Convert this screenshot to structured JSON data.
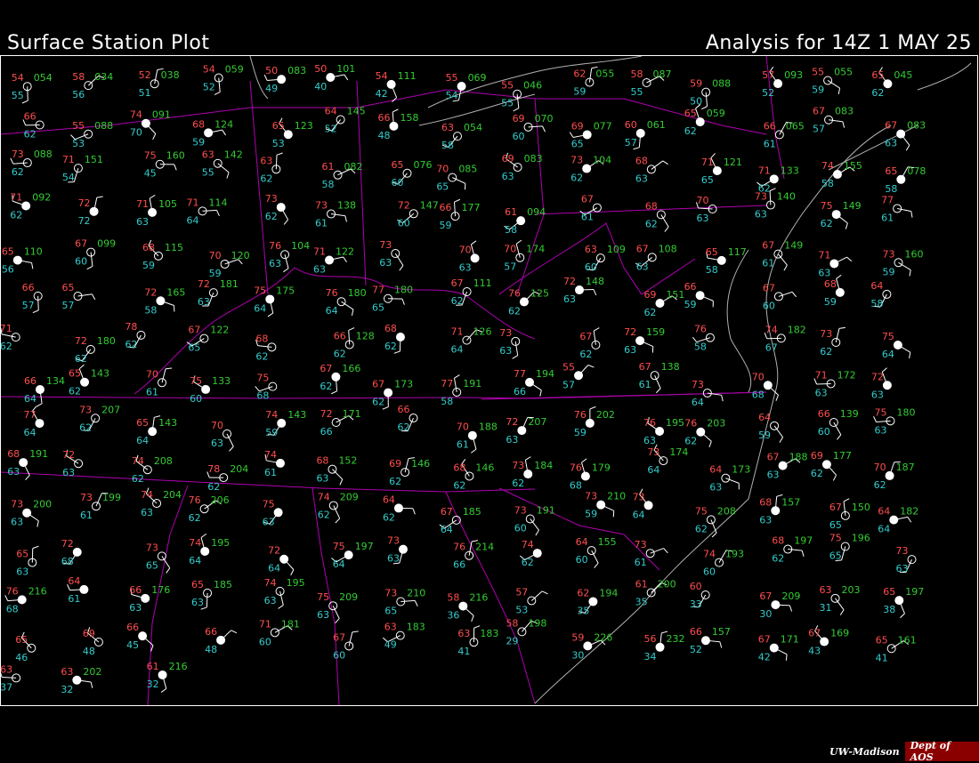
{
  "header": {
    "title": "Surface Station Plot",
    "analysis": "Analysis for 14Z  1 MAY 25"
  },
  "credit": {
    "institution": "UW-Madison",
    "department": "Dept of AOS"
  },
  "colors": {
    "background": "#000000",
    "temperature": "#ff4d4d",
    "dewpoint": "#33cccc",
    "pressure": "#33cc33",
    "state_boundary": "#b000b0",
    "coastline": "#b0b0b0",
    "station": "#ffffff",
    "weather_symbol": "#ffff00"
  },
  "stations": [
    {
      "t": "54",
      "td": "55",
      "p": "054"
    },
    {
      "t": "58",
      "td": "56",
      "p": "034"
    },
    {
      "t": "52",
      "td": "51",
      "p": "038"
    },
    {
      "t": "54",
      "td": "52",
      "p": "059"
    },
    {
      "t": "50",
      "td": "49",
      "p": "083"
    },
    {
      "t": "50",
      "td": "40",
      "p": "101"
    },
    {
      "t": "54",
      "td": "42",
      "p": "111"
    },
    {
      "t": "55",
      "td": "54",
      "p": "069"
    },
    {
      "t": "55",
      "td": "55",
      "p": "046"
    },
    {
      "t": "62",
      "td": "59",
      "p": "055"
    },
    {
      "t": "58",
      "td": "55",
      "p": "087"
    },
    {
      "t": "59",
      "td": "50",
      "p": "088"
    },
    {
      "t": "57",
      "td": "52",
      "p": "093"
    },
    {
      "t": "55",
      "td": "59",
      "p": "055"
    },
    {
      "t": "65",
      "td": "62",
      "p": "045"
    },
    {
      "t": "66",
      "td": "62",
      "p": ""
    },
    {
      "t": "55",
      "td": "53",
      "p": "088"
    },
    {
      "t": "74",
      "td": "70",
      "p": "091"
    },
    {
      "t": "68",
      "td": "59",
      "p": "124"
    },
    {
      "t": "65",
      "td": "53",
      "p": "123"
    },
    {
      "t": "64",
      "td": "52",
      "p": "145"
    },
    {
      "t": "66",
      "td": "48",
      "p": "158"
    },
    {
      "t": "63",
      "td": "58",
      "p": "054"
    },
    {
      "t": "69",
      "td": "60",
      "p": "070"
    },
    {
      "t": "69",
      "td": "65",
      "p": "077"
    },
    {
      "t": "60",
      "td": "57",
      "p": "061"
    },
    {
      "t": "65",
      "td": "62",
      "p": "059"
    },
    {
      "t": "66",
      "td": "61",
      "p": "065"
    },
    {
      "t": "67",
      "td": "57",
      "p": "083"
    },
    {
      "t": "67",
      "td": "63",
      "p": "083"
    },
    {
      "t": "73",
      "td": "62",
      "p": "088"
    },
    {
      "t": "71",
      "td": "54",
      "p": "151"
    },
    {
      "t": "75",
      "td": "45",
      "p": "160"
    },
    {
      "t": "63",
      "td": "55",
      "p": "142"
    },
    {
      "t": "63",
      "td": "62",
      "p": ""
    },
    {
      "t": "61",
      "td": "58",
      "p": "082"
    },
    {
      "t": "65",
      "td": "60",
      "p": "076"
    },
    {
      "t": "70",
      "td": "65",
      "p": "085"
    },
    {
      "t": "69",
      "td": "63",
      "p": "083"
    },
    {
      "t": "73",
      "td": "62",
      "p": "104"
    },
    {
      "t": "68",
      "td": "63",
      "p": ""
    },
    {
      "t": "71",
      "td": "65",
      "p": "121"
    },
    {
      "t": "71",
      "td": "62",
      "p": "133"
    },
    {
      "t": "74",
      "td": "58",
      "p": "155"
    },
    {
      "t": "65",
      "td": "58",
      "p": "078"
    },
    {
      "t": "71",
      "td": "62",
      "p": "092"
    },
    {
      "t": "72",
      "td": "72",
      "p": ""
    },
    {
      "t": "71",
      "td": "63",
      "p": "105"
    },
    {
      "t": "71",
      "td": "64",
      "p": "114"
    },
    {
      "t": "73",
      "td": "62",
      "p": ""
    },
    {
      "t": "73",
      "td": "61",
      "p": "138"
    },
    {
      "t": "72",
      "td": "60",
      "p": "147"
    },
    {
      "t": "66",
      "td": "59",
      "p": "177"
    },
    {
      "t": "61",
      "td": "58",
      "p": "094"
    },
    {
      "t": "67",
      "td": "61",
      "p": ""
    },
    {
      "t": "68",
      "td": "62",
      "p": ""
    },
    {
      "t": "70",
      "td": "63",
      "p": ""
    },
    {
      "t": "73",
      "td": "63",
      "p": "140"
    },
    {
      "t": "75",
      "td": "62",
      "p": "149"
    },
    {
      "t": "77",
      "td": "61",
      "p": ""
    },
    {
      "t": "65",
      "td": "56",
      "p": "110"
    },
    {
      "t": "67",
      "td": "60",
      "p": "099"
    },
    {
      "t": "68",
      "td": "59",
      "p": "115"
    },
    {
      "t": "70",
      "td": "59",
      "p": "120"
    },
    {
      "t": "76",
      "td": "63",
      "p": "104"
    },
    {
      "t": "71",
      "td": "63",
      "p": "122"
    },
    {
      "t": "73",
      "td": "63",
      "p": ""
    },
    {
      "t": "70",
      "td": "63",
      "p": ""
    },
    {
      "t": "70",
      "td": "57",
      "p": "174"
    },
    {
      "t": "63",
      "td": "60",
      "p": "109"
    },
    {
      "t": "67",
      "td": "63",
      "p": "108"
    },
    {
      "t": "65",
      "td": "58",
      "p": "117"
    },
    {
      "t": "67",
      "td": "61",
      "p": "149"
    },
    {
      "t": "71",
      "td": "63",
      "p": ""
    },
    {
      "t": "73",
      "td": "59",
      "p": "160"
    },
    {
      "t": "66",
      "td": "57",
      "p": ""
    },
    {
      "t": "65",
      "td": "57",
      "p": ""
    },
    {
      "t": "72",
      "td": "58",
      "p": "165"
    },
    {
      "t": "72",
      "td": "63",
      "p": "181"
    },
    {
      "t": "75",
      "td": "64",
      "p": "175"
    },
    {
      "t": "76",
      "td": "64",
      "p": "180"
    },
    {
      "t": "77",
      "td": "65",
      "p": "180"
    },
    {
      "t": "67",
      "td": "62",
      "p": "111"
    },
    {
      "t": "76",
      "td": "62",
      "p": "125"
    },
    {
      "t": "72",
      "td": "63",
      "p": "148"
    },
    {
      "t": "69",
      "td": "62",
      "p": "151"
    },
    {
      "t": "66",
      "td": "59",
      "p": ""
    },
    {
      "t": "67",
      "td": "60",
      "p": ""
    },
    {
      "t": "68",
      "td": "59",
      "p": ""
    },
    {
      "t": "64",
      "td": "58",
      "p": ""
    },
    {
      "t": "71",
      "td": "62",
      "p": ""
    },
    {
      "t": "72",
      "td": "62",
      "p": "180"
    },
    {
      "t": "78",
      "td": "62",
      "p": ""
    },
    {
      "t": "67",
      "td": "65",
      "p": "122"
    },
    {
      "t": "68",
      "td": "62",
      "p": ""
    },
    {
      "t": "66",
      "td": "62",
      "p": "128"
    },
    {
      "t": "68",
      "td": "62",
      "p": ""
    },
    {
      "t": "71",
      "td": "64",
      "p": "126"
    },
    {
      "t": "73",
      "td": "63",
      "p": ""
    },
    {
      "t": "67",
      "td": "62",
      "p": ""
    },
    {
      "t": "72",
      "td": "63",
      "p": "159"
    },
    {
      "t": "76",
      "td": "58",
      "p": ""
    },
    {
      "t": "74",
      "td": "67",
      "p": "182"
    },
    {
      "t": "73",
      "td": "62",
      "p": ""
    },
    {
      "t": "75",
      "td": "64",
      "p": ""
    },
    {
      "t": "66",
      "td": "64",
      "p": "134"
    },
    {
      "t": "65",
      "td": "62",
      "p": "143"
    },
    {
      "t": "70",
      "td": "61",
      "p": ""
    },
    {
      "t": "75",
      "td": "60",
      "p": "133"
    },
    {
      "t": "75",
      "td": "68",
      "p": ""
    },
    {
      "t": "67",
      "td": "62",
      "p": "166"
    },
    {
      "t": "67",
      "td": "62",
      "p": "173"
    },
    {
      "t": "77",
      "td": "58",
      "p": "191"
    },
    {
      "t": "77",
      "td": "66",
      "p": "194"
    },
    {
      "t": "55",
      "td": "57",
      "p": ""
    },
    {
      "t": "67",
      "td": "61",
      "p": "138"
    },
    {
      "t": "73",
      "td": "64",
      "p": ""
    },
    {
      "t": "70",
      "td": "68",
      "p": ""
    },
    {
      "t": "71",
      "td": "63",
      "p": "172"
    },
    {
      "t": "72",
      "td": "63",
      "p": ""
    },
    {
      "t": "77",
      "td": "64",
      "p": ""
    },
    {
      "t": "73",
      "td": "62",
      "p": "207"
    },
    {
      "t": "65",
      "td": "64",
      "p": "143"
    },
    {
      "t": "70",
      "td": "63",
      "p": ""
    },
    {
      "t": "74",
      "td": "59",
      "p": "143"
    },
    {
      "t": "72",
      "td": "66",
      "p": "171"
    },
    {
      "t": "66",
      "td": "62",
      "p": ""
    },
    {
      "t": "70",
      "td": "61",
      "p": "188"
    },
    {
      "t": "72",
      "td": "63",
      "p": "207"
    },
    {
      "t": "76",
      "td": "59",
      "p": "202"
    },
    {
      "t": "76",
      "td": "63",
      "p": "195"
    },
    {
      "t": "76",
      "td": "62",
      "p": "203"
    },
    {
      "t": "64",
      "td": "59",
      "p": ""
    },
    {
      "t": "66",
      "td": "60",
      "p": "139"
    },
    {
      "t": "75",
      "td": "63",
      "p": "180"
    },
    {
      "t": "68",
      "td": "63",
      "p": "191"
    },
    {
      "t": "72",
      "td": "63",
      "p": ""
    },
    {
      "t": "74",
      "td": "62",
      "p": "208"
    },
    {
      "t": "78",
      "td": "62",
      "p": "204"
    },
    {
      "t": "74",
      "td": "61",
      "p": ""
    },
    {
      "t": "68",
      "td": "63",
      "p": "152"
    },
    {
      "t": "69",
      "td": "62",
      "p": "146"
    },
    {
      "t": "68",
      "td": "62",
      "p": "146"
    },
    {
      "t": "73",
      "td": "62",
      "p": "184"
    },
    {
      "t": "76",
      "td": "68",
      "p": "179"
    },
    {
      "t": "73",
      "td": "64",
      "p": "174"
    },
    {
      "t": "64",
      "td": "63",
      "p": "173"
    },
    {
      "t": "67",
      "td": "63",
      "p": "188"
    },
    {
      "t": "69",
      "td": "62",
      "p": "177"
    },
    {
      "t": "70",
      "td": "62",
      "p": "187"
    },
    {
      "t": "73",
      "td": "63",
      "p": "200"
    },
    {
      "t": "73",
      "td": "61",
      "p": "199"
    },
    {
      "t": "74",
      "td": "63",
      "p": "204"
    },
    {
      "t": "76",
      "td": "62",
      "p": "206"
    },
    {
      "t": "75",
      "td": "63",
      "p": ""
    },
    {
      "t": "74",
      "td": "62",
      "p": "209"
    },
    {
      "t": "64",
      "td": "62",
      "p": ""
    },
    {
      "t": "67",
      "td": "64",
      "p": "185"
    },
    {
      "t": "73",
      "td": "60",
      "p": "191"
    },
    {
      "t": "73",
      "td": "59",
      "p": "210"
    },
    {
      "t": "73",
      "td": "64",
      "p": ""
    },
    {
      "t": "75",
      "td": "62",
      "p": "208"
    },
    {
      "t": "68",
      "td": "63",
      "p": "157"
    },
    {
      "t": "67",
      "td": "65",
      "p": "150"
    },
    {
      "t": "64",
      "td": "64",
      "p": "182"
    },
    {
      "t": "65",
      "td": "63",
      "p": ""
    },
    {
      "t": "72",
      "td": "68",
      "p": ""
    },
    {
      "t": "73",
      "td": "65",
      "p": ""
    },
    {
      "t": "74",
      "td": "64",
      "p": "195"
    },
    {
      "t": "72",
      "td": "64",
      "p": ""
    },
    {
      "t": "75",
      "td": "64",
      "p": "197"
    },
    {
      "t": "73",
      "td": "63",
      "p": ""
    },
    {
      "t": "76",
      "td": "66",
      "p": "214"
    },
    {
      "t": "74",
      "td": "62",
      "p": ""
    },
    {
      "t": "64",
      "td": "60",
      "p": "155"
    },
    {
      "t": "73",
      "td": "61",
      "p": ""
    },
    {
      "t": "74",
      "td": "60",
      "p": "193"
    },
    {
      "t": "68",
      "td": "62",
      "p": "197"
    },
    {
      "t": "75",
      "td": "65",
      "p": "196"
    },
    {
      "t": "73",
      "td": "63",
      "p": ""
    },
    {
      "t": "76",
      "td": "68",
      "p": "216"
    },
    {
      "t": "64",
      "td": "61",
      "p": ""
    },
    {
      "t": "66",
      "td": "63",
      "p": "176"
    },
    {
      "t": "65",
      "td": "63",
      "p": "185"
    },
    {
      "t": "74",
      "td": "63",
      "p": "195"
    },
    {
      "t": "75",
      "td": "63",
      "p": "209"
    },
    {
      "t": "73",
      "td": "65",
      "p": "210"
    },
    {
      "t": "58",
      "td": "36",
      "p": "216"
    },
    {
      "t": "57",
      "td": "53",
      "p": ""
    },
    {
      "t": "62",
      "td": "35",
      "p": "194"
    },
    {
      "t": "61",
      "td": "35",
      "p": "200"
    },
    {
      "t": "60",
      "td": "33",
      "p": ""
    },
    {
      "t": "67",
      "td": "30",
      "p": "209"
    },
    {
      "t": "63",
      "td": "31",
      "p": "203"
    },
    {
      "t": "65",
      "td": "38",
      "p": "197"
    },
    {
      "t": "65",
      "td": "46",
      "p": ""
    },
    {
      "t": "69",
      "td": "48",
      "p": ""
    },
    {
      "t": "66",
      "td": "45",
      "p": ""
    },
    {
      "t": "66",
      "td": "48",
      "p": ""
    },
    {
      "t": "71",
      "td": "60",
      "p": "181"
    },
    {
      "t": "67",
      "td": "60",
      "p": ""
    },
    {
      "t": "63",
      "td": "49",
      "p": "183"
    },
    {
      "t": "63",
      "td": "41",
      "p": "183"
    },
    {
      "t": "58",
      "td": "29",
      "p": "198"
    },
    {
      "t": "59",
      "td": "30",
      "p": "226"
    },
    {
      "t": "56",
      "td": "34",
      "p": "232"
    },
    {
      "t": "66",
      "td": "52",
      "p": "157"
    },
    {
      "t": "67",
      "td": "42",
      "p": "171"
    },
    {
      "t": "67",
      "td": "43",
      "p": "169"
    },
    {
      "t": "65",
      "td": "41",
      "p": "161"
    },
    {
      "t": "63",
      "td": "37",
      "p": ""
    },
    {
      "t": "63",
      "td": "32",
      "p": "202"
    },
    {
      "t": "61",
      "td": "32",
      "p": "216"
    }
  ]
}
